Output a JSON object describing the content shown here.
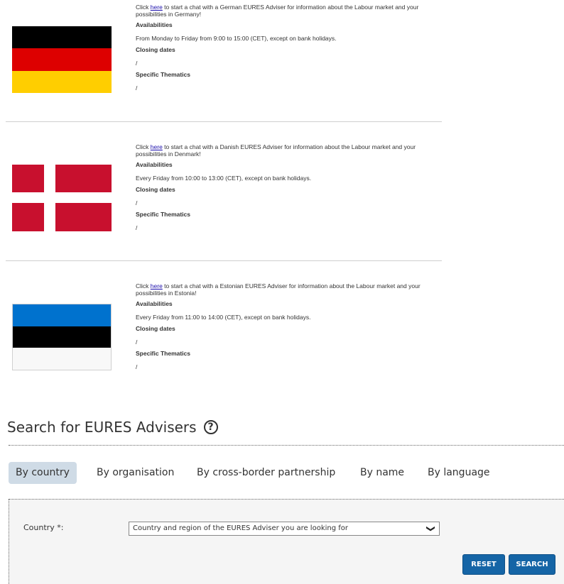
{
  "entries": [
    {
      "intro_pre": "Click ",
      "link": "here",
      "intro_post": " to start a chat with a German EURES Adviser for information about the Labour market and your possibilities in Germany!",
      "availabilities_label": "Availabilities",
      "availabilities": "From Monday to Friday from 9:00 to 15:00 (CET), except on bank holidays.",
      "closing_label": "Closing dates",
      "closing": "/",
      "thematics_label": "Specific Thematics",
      "thematics": "/",
      "flag_colors": [
        "#000000",
        "#dd0000",
        "#ffce00"
      ]
    },
    {
      "intro_pre": "Click ",
      "link": "here",
      "intro_post": " to start a chat with a Danish EURES Adviser for information about the Labour market and your possibilities in Denmark!",
      "availabilities_label": "Availabilities",
      "availabilities": "Every Friday from 10:00 to 13:00 (CET), except on bank holidays.",
      "closing_label": "Closing dates",
      "closing": "/",
      "thematics_label": "Specific Thematics",
      "thematics": "/",
      "flag_colors": [
        "#c8102e",
        "#ffffff"
      ]
    },
    {
      "intro_pre": "Click ",
      "link": "here",
      "intro_post": " to start a chat with a Estonian EURES Adviser for information about the Labour market and your possibilities in Estonia!",
      "availabilities_label": "Availabilities",
      "availabilities": "Every Friday from 11:00 to 14:00 (CET), except on bank holidays.",
      "closing_label": "Closing dates",
      "closing": "/",
      "thematics_label": "Specific Thematics",
      "thematics": "/",
      "flag_colors": [
        "#0072ce",
        "#000000",
        "#f8f8f8"
      ]
    }
  ],
  "search": {
    "title": "Search for EURES Advisers",
    "help_icon": "?",
    "tabs": [
      "By country",
      "By organisation",
      "By cross-border partnership",
      "By name",
      "By language"
    ],
    "active_tab": "By country",
    "country_label": "Country *:",
    "country_select_value": "Country and region of the EURES Adviser you are looking for",
    "reset_label": "RESET",
    "search_label": "SEARCH",
    "button_color": "#1565a6"
  }
}
